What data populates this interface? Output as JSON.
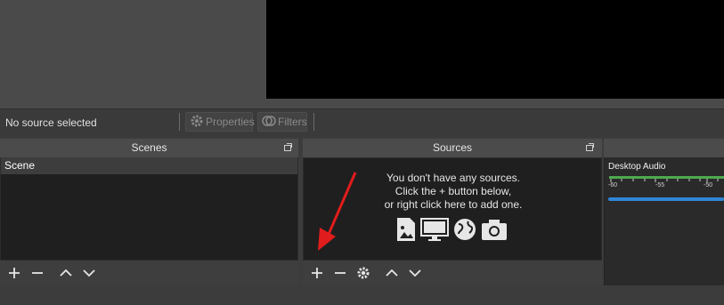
{
  "status": {
    "no_source": "No source selected"
  },
  "toolbar": {
    "properties_label": "Properties",
    "filters_label": "Filters"
  },
  "scenes": {
    "title": "Scenes",
    "items": [
      "Scene"
    ]
  },
  "sources": {
    "title": "Sources",
    "empty_lines": [
      "You don't have any sources.",
      "Click the + button below,",
      "or right click here to add one."
    ]
  },
  "audio": {
    "channel_label": "Desktop Audio",
    "scale_ticks": [
      "-60",
      "-55",
      "-50"
    ],
    "colors": {
      "meter": "#4ea94e",
      "slider": "#2f86d6"
    }
  },
  "icons": [
    "plus-icon",
    "minus-icon",
    "chevron-up-icon",
    "chevron-down-icon",
    "gear-icon",
    "image-icon",
    "monitor-icon",
    "globe-icon",
    "camera-icon"
  ]
}
